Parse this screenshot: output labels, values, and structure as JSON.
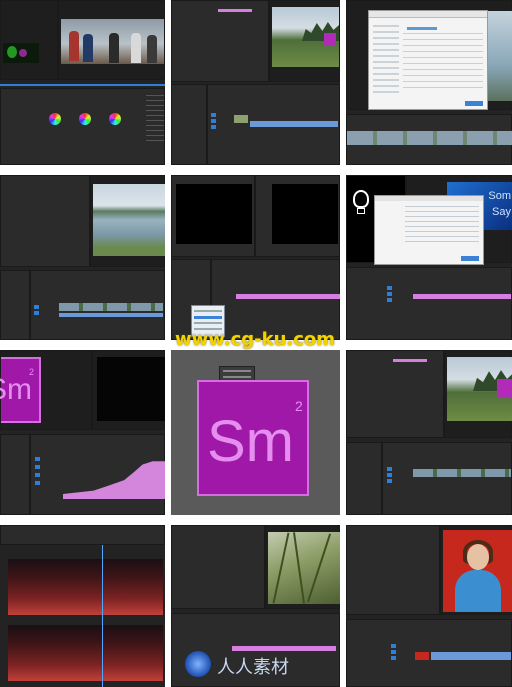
{
  "watermark": {
    "text": "www.cg-ku.com"
  },
  "bottom_logo": {
    "text": "人人素材"
  },
  "tiles": [
    {
      "id": "1-1",
      "name": "color-correction-workspace"
    },
    {
      "id": "1-2",
      "name": "timeline-landscape-preview"
    },
    {
      "id": "1-3",
      "name": "import-dialog"
    },
    {
      "id": "2-1",
      "name": "lake-preview"
    },
    {
      "id": "2-2",
      "name": "black-preview-context-menu"
    },
    {
      "id": "2-3",
      "name": "bulb-import-dialog"
    },
    {
      "id": "3-1",
      "name": "sm-title-keyframes"
    },
    {
      "id": "3-2",
      "name": "sm-title-large"
    },
    {
      "id": "3-3",
      "name": "landscape-sm-overlay"
    },
    {
      "id": "4-1",
      "name": "audio-spectral"
    },
    {
      "id": "4-2",
      "name": "grass-preview"
    },
    {
      "id": "4-3",
      "name": "presenter-preview"
    }
  ],
  "sm_title": {
    "letters": "Sm",
    "superscript": "2"
  },
  "bulb_title": {
    "line1": "Som",
    "line2": "Say"
  },
  "colors": {
    "accent_pink": "#d77fe0",
    "accent_blue": "#2f7fd8",
    "sm_magenta": "#a018a8",
    "watermark_yellow": "#f2d400"
  }
}
